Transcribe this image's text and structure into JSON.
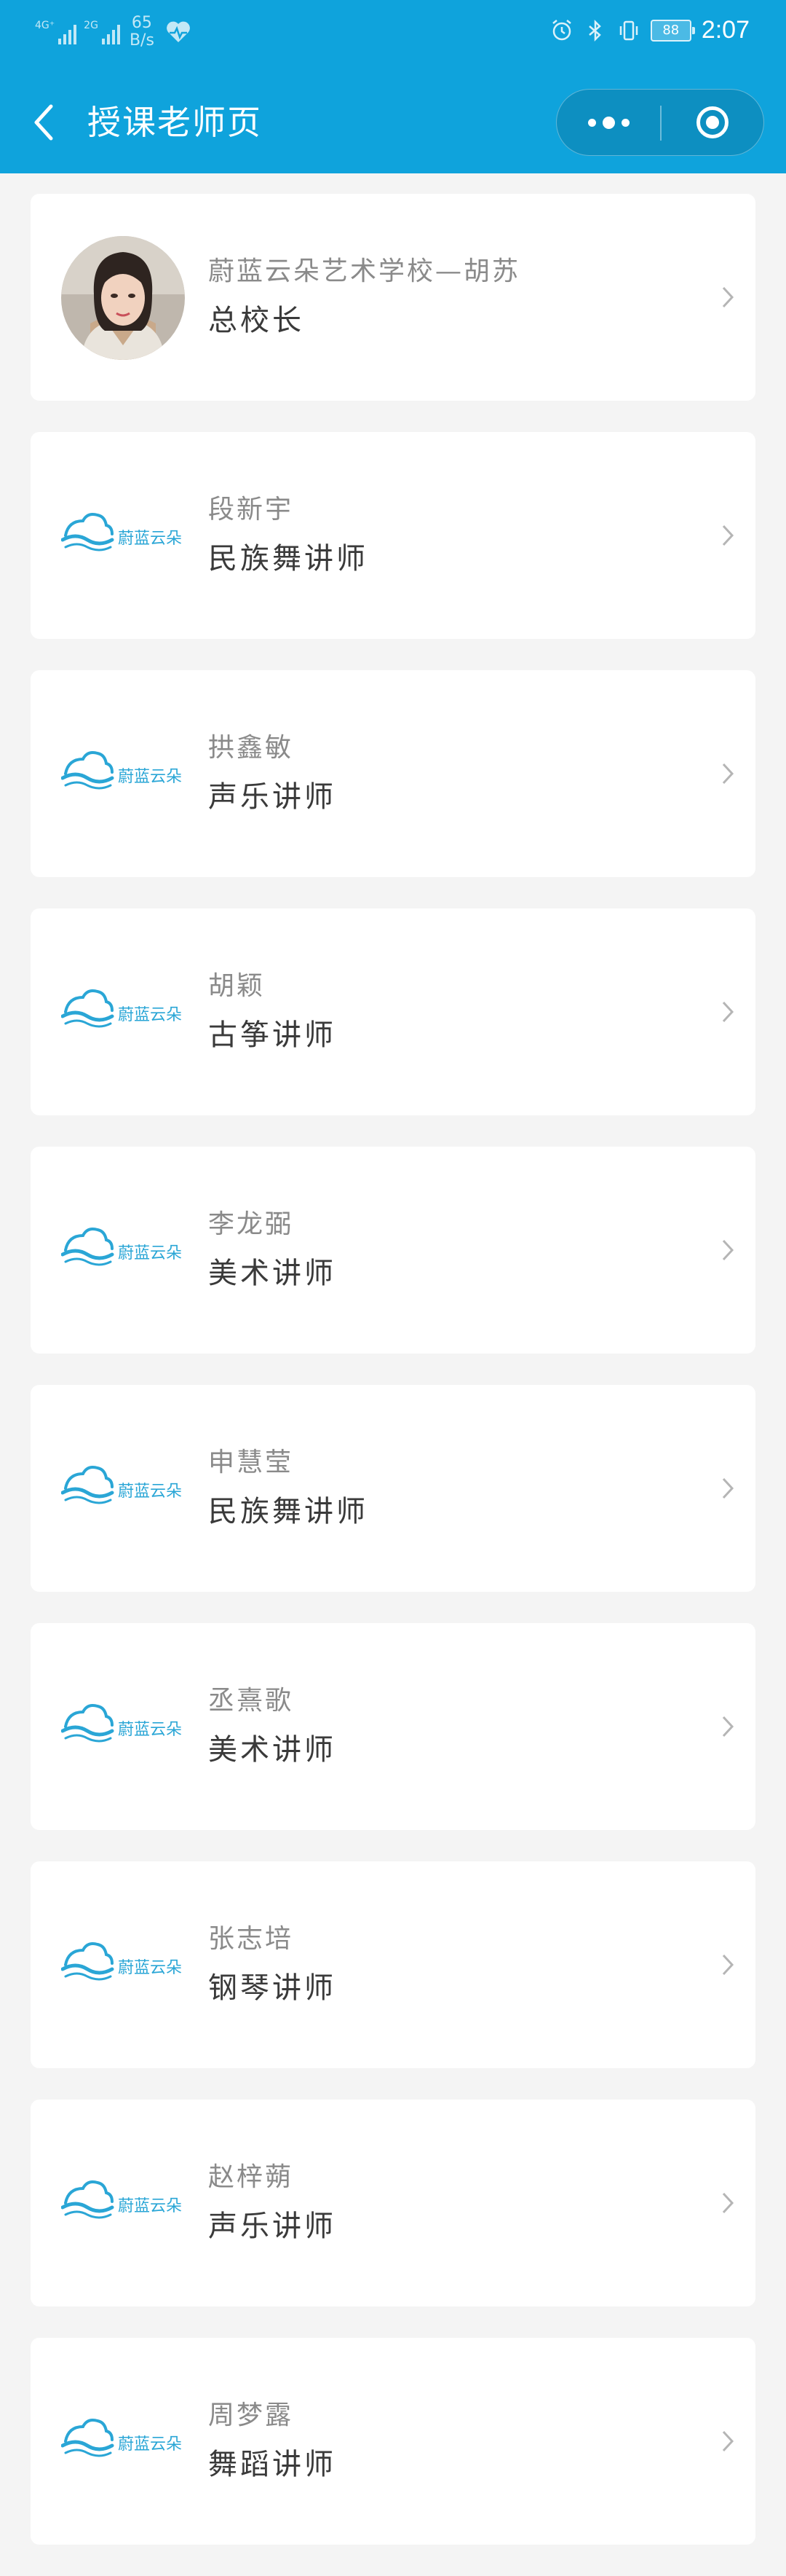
{
  "status_bar": {
    "net1": "4G⁺",
    "net2": "2G",
    "speed_value": "65",
    "speed_unit": "B/s",
    "battery": "88",
    "time": "2:07"
  },
  "nav": {
    "title": "授课老师页"
  },
  "teachers": [
    {
      "name": "蔚蓝云朵艺术学校—胡苏",
      "role": "总校长",
      "avatar": "photo"
    },
    {
      "name": "段新宇",
      "role": "民族舞讲师",
      "avatar": "logo"
    },
    {
      "name": "拱鑫敏",
      "role": "声乐讲师",
      "avatar": "logo"
    },
    {
      "name": "胡颖",
      "role": "古筝讲师",
      "avatar": "logo"
    },
    {
      "name": "李龙弼",
      "role": "美术讲师",
      "avatar": "logo"
    },
    {
      "name": "申慧莹",
      "role": "民族舞讲师",
      "avatar": "logo"
    },
    {
      "name": "丞熹歌",
      "role": "美术讲师",
      "avatar": "logo"
    },
    {
      "name": "张志培",
      "role": "钢琴讲师",
      "avatar": "logo"
    },
    {
      "name": "赵梓蒴",
      "role": "声乐讲师",
      "avatar": "logo"
    },
    {
      "name": "周梦露",
      "role": "舞蹈讲师",
      "avatar": "logo"
    }
  ],
  "logo_text": "蔚蓝云朵",
  "colors": {
    "header": "#0fa3dc",
    "background": "#f4f4f4",
    "card": "#ffffff",
    "logo": "#2aa6d6"
  }
}
